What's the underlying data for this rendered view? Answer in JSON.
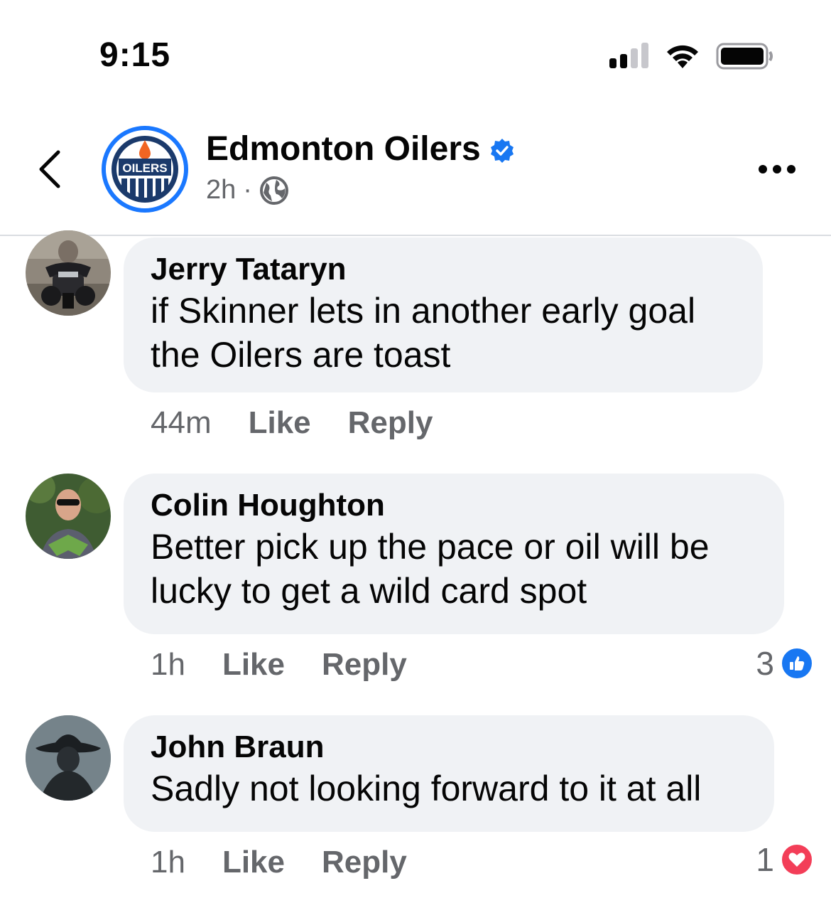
{
  "status_bar": {
    "time": "9:15"
  },
  "header": {
    "page_name": "Edmonton Oilers",
    "time_ago": "2h",
    "separator": "·",
    "logo_text": "OILERS"
  },
  "colors": {
    "accent_blue": "#1877f2",
    "love_red": "#f33e58",
    "bubble_bg": "#f0f2f5",
    "muted_text": "#65676b"
  },
  "comments": [
    {
      "author": "Jerry Tataryn",
      "text_lines": [
        "if Skinner lets in another early goal",
        "the Oilers are toast"
      ],
      "time": "44m",
      "like_label": "Like",
      "reply_label": "Reply",
      "reaction_count": null
    },
    {
      "author": "Colin Houghton",
      "text_lines": [
        "Better pick up the pace or oil will be",
        "lucky to get a wild card spot"
      ],
      "time": "1h",
      "like_label": "Like",
      "reply_label": "Reply",
      "reaction_count": "3",
      "reaction_icon": "like-icon"
    },
    {
      "author": "John Braun",
      "text_lines": [
        "Sadly not looking forward to it at all"
      ],
      "time": "1h",
      "like_label": "Like",
      "reply_label": "Reply",
      "reaction_count": "1",
      "reaction_icon": "love-icon"
    }
  ]
}
